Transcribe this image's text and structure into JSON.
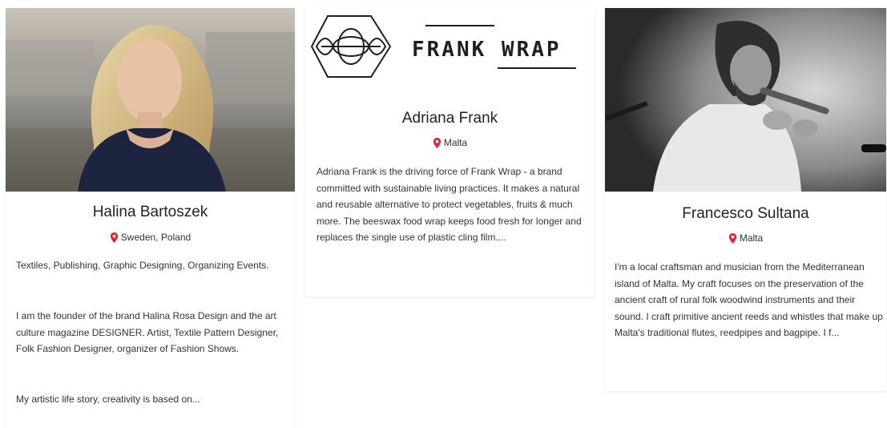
{
  "colors": {
    "pin": "#e0232f",
    "logo": "#1f1f1f"
  },
  "cards": [
    {
      "name": "Halina Bartoszek",
      "location": "Sweden, Poland",
      "icon": "map-pin-icon",
      "paragraphs": [
        "Textiles, Publishing, Graphic Designing, Organizing Events.",
        "I am the founder of the brand Halina Rosa Design and the art culture  magazine DESIGNER. Artist, Textile Pattern Designer, Folk Fashion Designer, organizer of Fashion Shows.",
        "My artistic life story, creativity is based on..."
      ]
    },
    {
      "logo_text": "FRANK WRAP",
      "name": "Adriana Frank",
      "location": "Malta",
      "icon": "map-pin-icon",
      "paragraphs": [
        "Adriana Frank is the driving force of Frank Wrap - a brand committed with sustainable living practices. It makes a natural and reusable alternative to protect vegetables, fruits & much more. The beeswax food wrap keeps food fresh for longer and replaces the single use of plastic cling film...."
      ]
    },
    {
      "name": "Francesco Sultana",
      "location": "Malta",
      "icon": "map-pin-icon",
      "paragraphs": [
        "I'm a local craftsman and musician from the Mediterranean island of Malta. My craft focuses on the preservation of the ancient craft of rural folk woodwind instruments and their sound. I craft primitive ancient reeds and whistles that make up Malta's traditional flutes, reedpipes and bagpipe. I f..."
      ]
    }
  ]
}
